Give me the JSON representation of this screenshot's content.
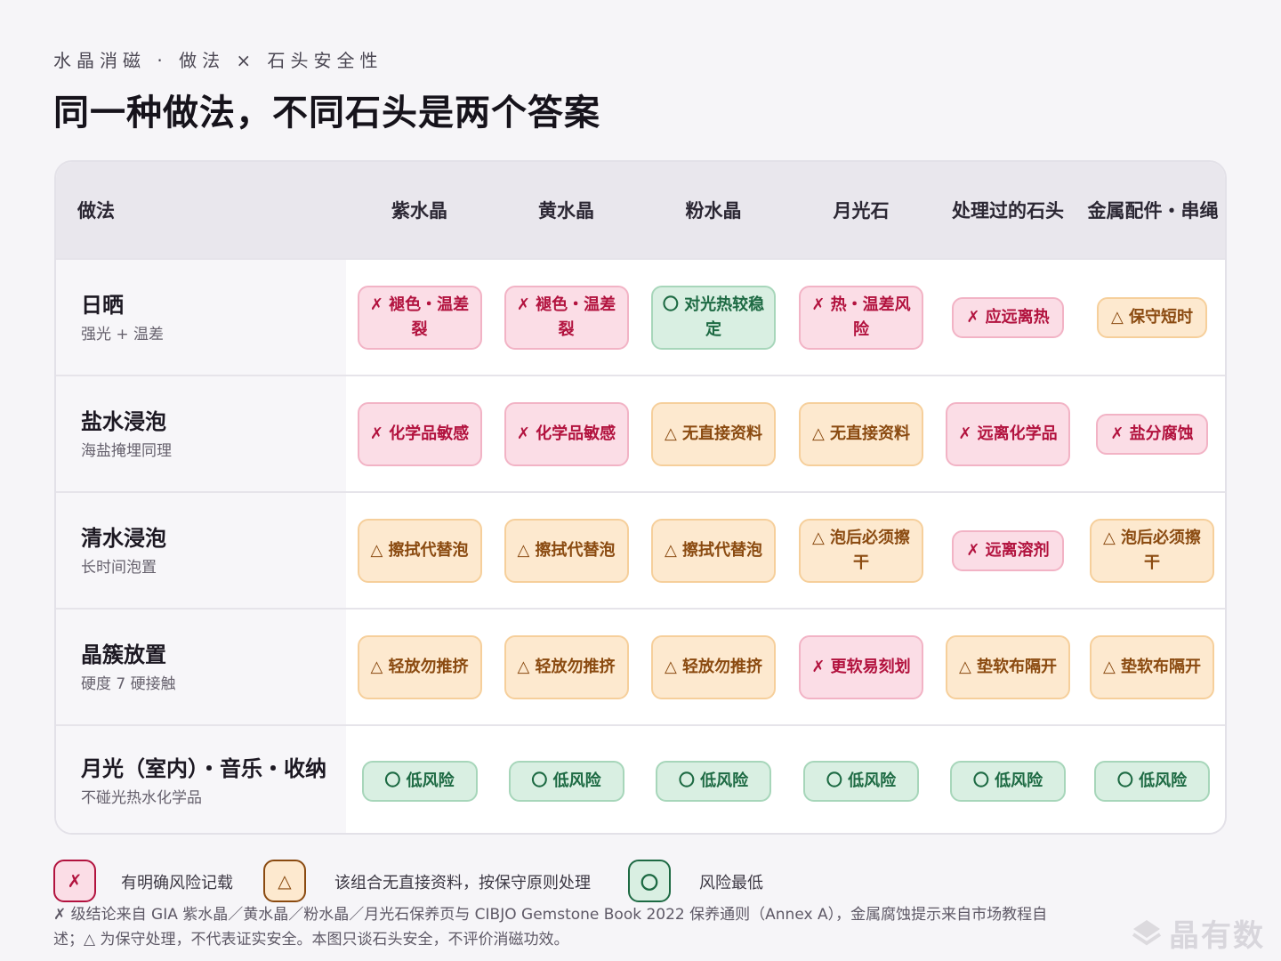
{
  "header": {
    "kicker": "水晶消磁 · 做法 × 石头安全性",
    "title": "同一种做法，不同石头是两个答案"
  },
  "table": {
    "method_header": "做法",
    "columns": [
      "紫水晶",
      "黄水晶",
      "粉水晶",
      "月光石",
      "处理过的石头",
      "金属配件・串绳"
    ],
    "rows": [
      {
        "name": "日晒",
        "sub": "强光 + 温差",
        "cells": [
          {
            "status": "x",
            "text": "✗ 褪色・温差裂"
          },
          {
            "status": "x",
            "text": "✗ 褪色・温差裂"
          },
          {
            "status": "o",
            "text": "〇 对光热较稳定"
          },
          {
            "status": "x",
            "text": "✗ 热・温差风险"
          },
          {
            "status": "x",
            "text": "✗ 应远离热"
          },
          {
            "status": "tri",
            "text": "△ 保守短时"
          }
        ]
      },
      {
        "name": "盐水浸泡",
        "sub": "海盐掩埋同理",
        "cells": [
          {
            "status": "x",
            "text": "✗ 化学品敏感"
          },
          {
            "status": "x",
            "text": "✗ 化学品敏感"
          },
          {
            "status": "tri",
            "text": "△ 无直接资料"
          },
          {
            "status": "tri",
            "text": "△ 无直接资料"
          },
          {
            "status": "x",
            "text": "✗ 远离化学品"
          },
          {
            "status": "x",
            "text": "✗ 盐分腐蚀"
          }
        ]
      },
      {
        "name": "清水浸泡",
        "sub": "长时间泡置",
        "cells": [
          {
            "status": "tri",
            "text": "△ 擦拭代替泡"
          },
          {
            "status": "tri",
            "text": "△ 擦拭代替泡"
          },
          {
            "status": "tri",
            "text": "△ 擦拭代替泡"
          },
          {
            "status": "tri",
            "text": "△ 泡后必须擦干"
          },
          {
            "status": "x",
            "text": "✗ 远离溶剂"
          },
          {
            "status": "tri",
            "text": "△ 泡后必须擦干"
          }
        ]
      },
      {
        "name": "晶簇放置",
        "sub": "硬度 7 硬接触",
        "cells": [
          {
            "status": "tri",
            "text": "△ 轻放勿推挤"
          },
          {
            "status": "tri",
            "text": "△ 轻放勿推挤"
          },
          {
            "status": "tri",
            "text": "△ 轻放勿推挤"
          },
          {
            "status": "x",
            "text": "✗ 更软易刻划"
          },
          {
            "status": "tri",
            "text": "△ 垫软布隔开"
          },
          {
            "status": "tri",
            "text": "△ 垫软布隔开"
          }
        ]
      },
      {
        "name": "月光（室内）・音乐・收纳",
        "sub": "不碰光热水化学品",
        "cells": [
          {
            "status": "o",
            "text": "〇 低风险"
          },
          {
            "status": "o",
            "text": "〇 低风险"
          },
          {
            "status": "o",
            "text": "〇 低风险"
          },
          {
            "status": "o",
            "text": "〇 低风险"
          },
          {
            "status": "o",
            "text": "〇 低风险"
          },
          {
            "status": "o",
            "text": "〇 低风险"
          }
        ]
      }
    ]
  },
  "legend": [
    {
      "symbol": "✗",
      "status": "x",
      "label": "有明确风险记载"
    },
    {
      "symbol": "△",
      "status": "tri",
      "label": "该组合无直接资料，按保守原则处理"
    },
    {
      "symbol": "〇",
      "status": "o",
      "label": "风险最低"
    }
  ],
  "footnote": "✗ 级结论来自 GIA 紫水晶／黄水晶／粉水晶／月光石保养页与 CIBJO Gemstone Book 2022 保养通则（Annex A），金属腐蚀提示来自市场教程自述；△ 为保守处理，不代表证实安全。本图只谈石头安全，不评价消磁功效。",
  "watermark": "晶有数",
  "colors": {
    "risk_bg": "#fbdde6",
    "risk_text": "#b2123e",
    "caution_bg": "#fde9cf",
    "caution_text": "#8a4a10",
    "low_bg": "#d9efe2",
    "low_text": "#1d6a43"
  }
}
